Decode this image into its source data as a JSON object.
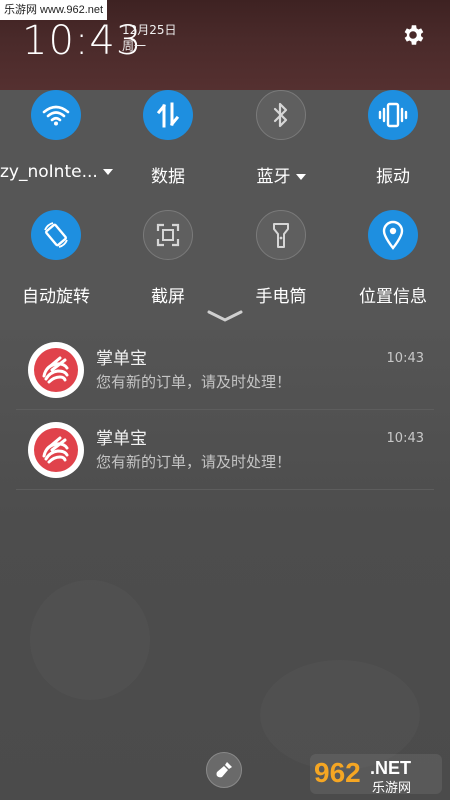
{
  "watermark": {
    "top_text": "乐游网 www.962.net",
    "bottom_text_big": "962",
    "bottom_text_net": ".NET",
    "bottom_text_cn": "乐游网"
  },
  "status": {
    "time": "10:43",
    "date": "12月25日",
    "weekday": "周一",
    "settings_icon": "gear-icon"
  },
  "quick_settings": {
    "row1": [
      {
        "label": "zy_noInte...",
        "icon": "wifi-icon",
        "state": "on",
        "has_dropdown": true
      },
      {
        "label": "数据",
        "icon": "mobile-data-icon",
        "state": "on",
        "has_dropdown": false
      },
      {
        "label": "蓝牙",
        "icon": "bluetooth-icon",
        "state": "off",
        "has_dropdown": true
      },
      {
        "label": "振动",
        "icon": "vibrate-icon",
        "state": "on",
        "has_dropdown": false
      }
    ],
    "row2": [
      {
        "label": "自动旋转",
        "icon": "rotate-icon",
        "state": "on"
      },
      {
        "label": "截屏",
        "icon": "screenshot-icon",
        "state": "off"
      },
      {
        "label": "手电筒",
        "icon": "flashlight-icon",
        "state": "off"
      },
      {
        "label": "位置信息",
        "icon": "location-icon",
        "state": "on"
      }
    ]
  },
  "notifications": [
    {
      "app": "掌单宝",
      "message": "您有新的订单，请及时处理！",
      "time": "10:43"
    },
    {
      "app": "掌单宝",
      "message": "您有新的订单，请及时处理！",
      "time": "10:43"
    }
  ],
  "colors": {
    "accent": "#1e8fe0",
    "panel": "#565656",
    "background": "#4a4a4a",
    "app_icon_red": "#e0424b"
  }
}
